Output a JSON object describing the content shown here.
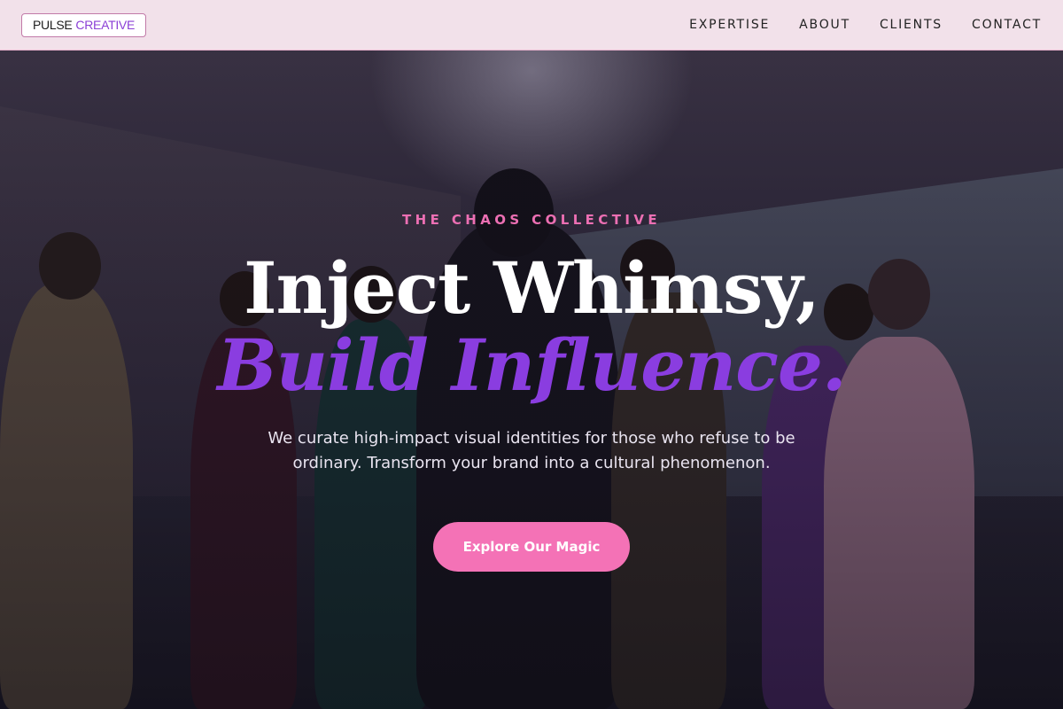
{
  "header": {
    "logo_part1": "PULSE",
    "logo_part2": "CREATIVE",
    "nav": [
      "EXPERTISE",
      "ABOUT",
      "CLIENTS",
      "CONTACT"
    ]
  },
  "hero": {
    "eyebrow": "THE CHAOS COLLECTIVE",
    "title_line1": "Inject Whimsy,",
    "title_line2": "Build Influence.",
    "subtitle": "We curate high-impact visual identities for those who refuse to be ordinary. Transform your brand into a cultural phenomenon.",
    "cta_label": "Explore Our Magic"
  },
  "colors": {
    "accent_pink": "#f472b6",
    "accent_purple": "#8a3de0",
    "header_bg": "#f2e1ea"
  }
}
